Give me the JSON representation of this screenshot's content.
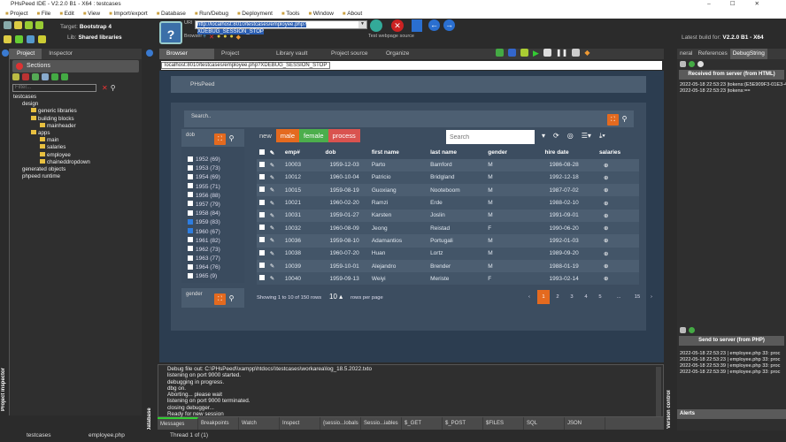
{
  "window": {
    "title": "PHsPeed IDE - V2.2.0 B1 - X64 : testcases",
    "controls": [
      "–",
      "☐",
      "✕"
    ]
  },
  "menu": [
    "Project",
    "File",
    "Edit",
    "View",
    "Import/export",
    "Database",
    "Run/Debug",
    "Deployment",
    "Tools",
    "Window",
    "About"
  ],
  "toolbar": {
    "target_label": "Target:",
    "target_value": "Bootstrap 4",
    "lib_label": "Lib:",
    "lib_value": "Shared libraries",
    "help": "?",
    "uri_label": "URI",
    "uri_value": "http://localhost:8010/testcases/employee.php?XDEBUG_SESSION_STOP",
    "browser_label": "Browser",
    "test_label": "Test webpage source",
    "latest_build_label": "Latest build for:",
    "latest_build_value": "V2.2.0 B1 - X64"
  },
  "left_panel": {
    "tabs": [
      "Project",
      "Inspector"
    ],
    "sections": "Sections",
    "filter_placeholder": "Filter...",
    "tree": [
      {
        "label": "testcases",
        "depth": 0
      },
      {
        "label": "design",
        "depth": 1
      },
      {
        "label": "generic libraries",
        "depth": 2
      },
      {
        "label": "building blocks",
        "depth": 2
      },
      {
        "label": "mainheader",
        "depth": 3
      },
      {
        "label": "apps",
        "depth": 2
      },
      {
        "label": "main",
        "depth": 3
      },
      {
        "label": "salaries",
        "depth": 3
      },
      {
        "label": "employee",
        "depth": 3
      },
      {
        "label": "chaineddropdown",
        "depth": 3
      },
      {
        "label": "generated objects",
        "depth": 1
      },
      {
        "label": "phpeed runtime",
        "depth": 1
      }
    ],
    "vertical_label": "Project inspector"
  },
  "center_tabs": [
    "Browser",
    "Project",
    "Library vault",
    "Project source",
    "Organize"
  ],
  "address": "localhost:8010/testcases/employee.php?XDEBUG_SESSION_STOP",
  "page": {
    "brand": "PHsPeed",
    "search_label": "Search..",
    "dob_label": "dob",
    "gender_label": "gender",
    "dob_filters": [
      {
        "label": "1952 (69)",
        "checked": false
      },
      {
        "label": "1953 (73)",
        "checked": false
      },
      {
        "label": "1954 (69)",
        "checked": false
      },
      {
        "label": "1955 (71)",
        "checked": false
      },
      {
        "label": "1956 (88)",
        "checked": false
      },
      {
        "label": "1957 (79)",
        "checked": false
      },
      {
        "label": "1958 (84)",
        "checked": false
      },
      {
        "label": "1959 (83)",
        "checked": true
      },
      {
        "label": "1960 (67)",
        "checked": true
      },
      {
        "label": "1961 (82)",
        "checked": false
      },
      {
        "label": "1962 (73)",
        "checked": false
      },
      {
        "label": "1963 (77)",
        "checked": false
      },
      {
        "label": "1964 (76)",
        "checked": false
      },
      {
        "label": "1965 (9)",
        "checked": false
      }
    ],
    "buttons": {
      "new": "new",
      "male": "male",
      "female": "female",
      "process": "process"
    },
    "colors": {
      "male": "#e46a1f",
      "female": "#4cae4c",
      "process": "#d9534f"
    },
    "table_search_placeholder": "Search",
    "columns": [
      "emp#",
      "dob",
      "first name",
      "last name",
      "gender",
      "hire date",
      "salaries"
    ],
    "rows": [
      [
        "10003",
        "1959-12-03",
        "Parto",
        "Bamford",
        "M",
        "1986-08-28"
      ],
      [
        "10012",
        "1960-10-04",
        "Patricio",
        "Bridgland",
        "M",
        "1992-12-18"
      ],
      [
        "10015",
        "1959-08-19",
        "Guoxiang",
        "Nooteboom",
        "M",
        "1987-07-02"
      ],
      [
        "10021",
        "1960-02-20",
        "Ramzi",
        "Erde",
        "M",
        "1988-02-10"
      ],
      [
        "10031",
        "1959-01-27",
        "Karsten",
        "Joslin",
        "M",
        "1991-09-01"
      ],
      [
        "10032",
        "1960-08-09",
        "Jeong",
        "Reistad",
        "F",
        "1990-06-20"
      ],
      [
        "10036",
        "1959-08-10",
        "Adamantios",
        "Portugali",
        "M",
        "1992-01-03"
      ],
      [
        "10038",
        "1960-07-20",
        "Huan",
        "Lortz",
        "M",
        "1989-09-20"
      ],
      [
        "10039",
        "1959-10-01",
        "Alejandro",
        "Brender",
        "M",
        "1988-01-19"
      ],
      [
        "10040",
        "1959-09-13",
        "Weiyi",
        "Meriste",
        "F",
        "1993-02-14"
      ]
    ],
    "showing": "Showing 1 to 10 of 150 rows",
    "page_size": "10",
    "rows_per_page": "rows per page",
    "pagination": [
      "‹",
      "1",
      "2",
      "3",
      "4",
      "5",
      "...",
      "15",
      "›"
    ],
    "current_page": "1"
  },
  "debug_lines": [
    "Debug file out: C:\\PHsPeed\\\\xampp\\htdocs\\\\testcases\\workarea\\log_18.5.2022.txto",
    "listening on port 9000 started.",
    "debugging in progress.",
    "dbg on.",
    "Aborting... please wait",
    "listening on port 9000 terminated.",
    "closing debugger...",
    "Ready for new session"
  ],
  "bottom_tabs": [
    "Messages",
    "Breakpoints",
    "Watch",
    "Inspect",
    "{sessio...lobals",
    "Sessio...iables",
    "$_GET",
    "$_POST",
    "$FILES",
    "SQL",
    "JSON"
  ],
  "status": {
    "project": "testcases",
    "file": "employee.php",
    "thread": "Thread 1 of (1)"
  },
  "right_panel": {
    "tabs": [
      "neral",
      "References",
      "DebugString"
    ],
    "received_header": "Received from server (from HTML)",
    "received_log": [
      "2022-05-18 22:53:23 |tokens:{E5E909F3-01E3-40F0",
      "2022-05-18 22:53:23 |tokens:=="
    ],
    "send_header": "Send to server (from PHP)",
    "send_log": [
      "2022-05-18 22:53:23 | employee.php 33: proc",
      "2022-05-18 22:53:23 | employee.php 33: proc",
      "2022-05-18 22:53:39 | employee.php 33: proc",
      "2022-05-18 22:53:39 | employee.php 33: proc"
    ],
    "alerts": "Alerts",
    "version_control": "Version control",
    "database": "Database"
  }
}
